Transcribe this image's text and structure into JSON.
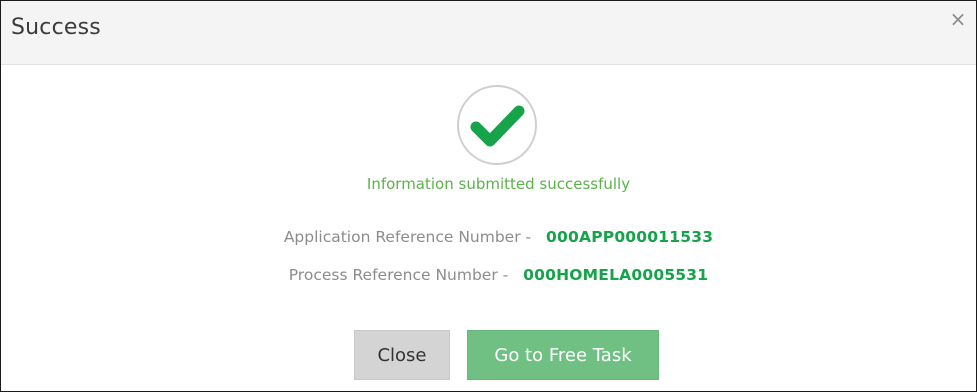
{
  "dialog": {
    "title": "Success",
    "close_glyph": "×"
  },
  "status": {
    "icon": "check-icon",
    "message": "Information submitted successfully",
    "accent_color": "#16a34a"
  },
  "references": [
    {
      "label": "Application Reference Number -",
      "value": "000APP000011533"
    },
    {
      "label": "Process Reference Number -",
      "value": "000HOMELA0005531"
    }
  ],
  "actions": {
    "close_label": "Close",
    "free_task_label": "Go to Free Task"
  }
}
